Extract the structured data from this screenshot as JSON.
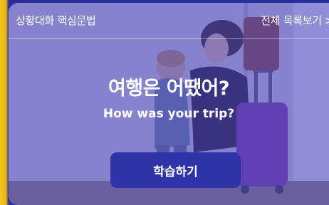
{
  "header": {
    "title": "상황대화 핵심문법",
    "view_all_label": "전체 목록보기",
    "view_all_icon": "chevron-right-icon"
  },
  "main": {
    "phrase_korean": "여행은 어땠어?",
    "phrase_english": "How was your trip?",
    "study_button_label": "학습하기"
  },
  "colors": {
    "accent_yellow": "#f3c61e",
    "overlay": "#4642cd",
    "button": "#2f35a8",
    "text": "#ffffff"
  }
}
